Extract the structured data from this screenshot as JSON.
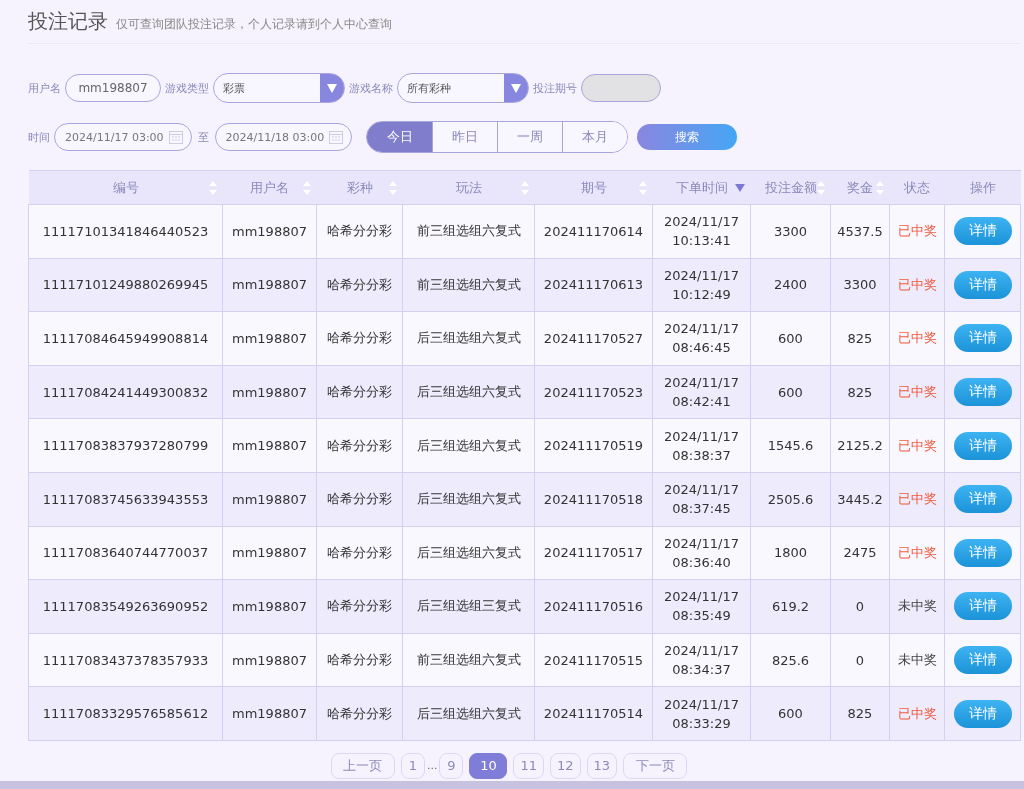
{
  "page": {
    "title": "投注记录",
    "subtitle": "仅可查询团队投注记录，个人记录请到个人中心查询"
  },
  "filters": {
    "username": {
      "label": "用户名",
      "value": "mm198807"
    },
    "game_type": {
      "label": "游戏类型",
      "value": "彩票"
    },
    "game_name": {
      "label": "游戏名称",
      "value": "所有彩种"
    },
    "period": {
      "label": "投注期号",
      "disabled": true
    },
    "time": {
      "label": "时间",
      "from": "2024/11/17 03:00",
      "separator": "至",
      "to": "2024/11/18 03:00"
    },
    "ranges": [
      {
        "label": "今日",
        "selected": true
      },
      {
        "label": "昨日",
        "selected": false
      },
      {
        "label": "一周",
        "selected": false
      },
      {
        "label": "本月",
        "selected": false
      }
    ],
    "search_button": "搜索"
  },
  "table": {
    "columns": [
      {
        "label": "编号",
        "sortable": true,
        "sorted_descending": false
      },
      {
        "label": "用户名",
        "sortable": true,
        "sorted_descending": false
      },
      {
        "label": "彩种",
        "sortable": true,
        "sorted_descending": false
      },
      {
        "label": "玩法",
        "sortable": true,
        "sorted_descending": false
      },
      {
        "label": "期号",
        "sortable": true,
        "sorted_descending": false
      },
      {
        "label": "下单时间",
        "sortable": true,
        "sorted_descending": true
      },
      {
        "label": "投注金额",
        "sortable": true,
        "sorted_descending": false
      },
      {
        "label": "奖金",
        "sortable": true,
        "sorted_descending": false
      },
      {
        "label": "状态",
        "sortable": false,
        "sorted_descending": false
      },
      {
        "label": "操作",
        "sortable": false,
        "sorted_descending": false
      }
    ],
    "rows": [
      {
        "id": "11117101341846440523",
        "user": "mm198807",
        "lottery": "哈希分分彩",
        "play": "前三组选组六复式",
        "period": "202411170614",
        "date": "2024/11/17",
        "time": "10:13:41",
        "amount": "3300",
        "prize": "4537.5",
        "status": "已中奖",
        "won": true,
        "action": "详情"
      },
      {
        "id": "11117101249880269945",
        "user": "mm198807",
        "lottery": "哈希分分彩",
        "play": "前三组选组六复式",
        "period": "202411170613",
        "date": "2024/11/17",
        "time": "10:12:49",
        "amount": "2400",
        "prize": "3300",
        "status": "已中奖",
        "won": true,
        "action": "详情"
      },
      {
        "id": "11117084645949908814",
        "user": "mm198807",
        "lottery": "哈希分分彩",
        "play": "后三组选组六复式",
        "period": "202411170527",
        "date": "2024/11/17",
        "time": "08:46:45",
        "amount": "600",
        "prize": "825",
        "status": "已中奖",
        "won": true,
        "action": "详情"
      },
      {
        "id": "11117084241449300832",
        "user": "mm198807",
        "lottery": "哈希分分彩",
        "play": "后三组选组六复式",
        "period": "202411170523",
        "date": "2024/11/17",
        "time": "08:42:41",
        "amount": "600",
        "prize": "825",
        "status": "已中奖",
        "won": true,
        "action": "详情"
      },
      {
        "id": "11117083837937280799",
        "user": "mm198807",
        "lottery": "哈希分分彩",
        "play": "后三组选组六复式",
        "period": "202411170519",
        "date": "2024/11/17",
        "time": "08:38:37",
        "amount": "1545.6",
        "prize": "2125.2",
        "status": "已中奖",
        "won": true,
        "action": "详情"
      },
      {
        "id": "11117083745633943553",
        "user": "mm198807",
        "lottery": "哈希分分彩",
        "play": "后三组选组六复式",
        "period": "202411170518",
        "date": "2024/11/17",
        "time": "08:37:45",
        "amount": "2505.6",
        "prize": "3445.2",
        "status": "已中奖",
        "won": true,
        "action": "详情"
      },
      {
        "id": "11117083640744770037",
        "user": "mm198807",
        "lottery": "哈希分分彩",
        "play": "后三组选组六复式",
        "period": "202411170517",
        "date": "2024/11/17",
        "time": "08:36:40",
        "amount": "1800",
        "prize": "2475",
        "status": "已中奖",
        "won": true,
        "action": "详情"
      },
      {
        "id": "11117083549263690952",
        "user": "mm198807",
        "lottery": "哈希分分彩",
        "play": "后三组选组三复式",
        "period": "202411170516",
        "date": "2024/11/17",
        "time": "08:35:49",
        "amount": "619.2",
        "prize": "0",
        "status": "未中奖",
        "won": false,
        "action": "详情"
      },
      {
        "id": "11117083437378357933",
        "user": "mm198807",
        "lottery": "哈希分分彩",
        "play": "前三组选组六复式",
        "period": "202411170515",
        "date": "2024/11/17",
        "time": "08:34:37",
        "amount": "825.6",
        "prize": "0",
        "status": "未中奖",
        "won": false,
        "action": "详情"
      },
      {
        "id": "11117083329576585612",
        "user": "mm198807",
        "lottery": "哈希分分彩",
        "play": "后三组选组六复式",
        "period": "202411170514",
        "date": "2024/11/17",
        "time": "08:33:29",
        "amount": "600",
        "prize": "825",
        "status": "已中奖",
        "won": true,
        "action": "详情"
      }
    ]
  },
  "pagination": [
    {
      "label": "上一页",
      "kind": "nav",
      "selected": false
    },
    {
      "label": "1",
      "kind": "page",
      "selected": false
    },
    {
      "label": "...",
      "kind": "ellipsis"
    },
    {
      "label": "9",
      "kind": "page",
      "selected": false
    },
    {
      "label": "10",
      "kind": "page",
      "selected": true
    },
    {
      "label": "11",
      "kind": "page",
      "selected": false
    },
    {
      "label": "12",
      "kind": "page",
      "selected": false
    },
    {
      "label": "13",
      "kind": "page",
      "selected": false
    },
    {
      "label": "下一页",
      "kind": "nav",
      "selected": false
    }
  ]
}
